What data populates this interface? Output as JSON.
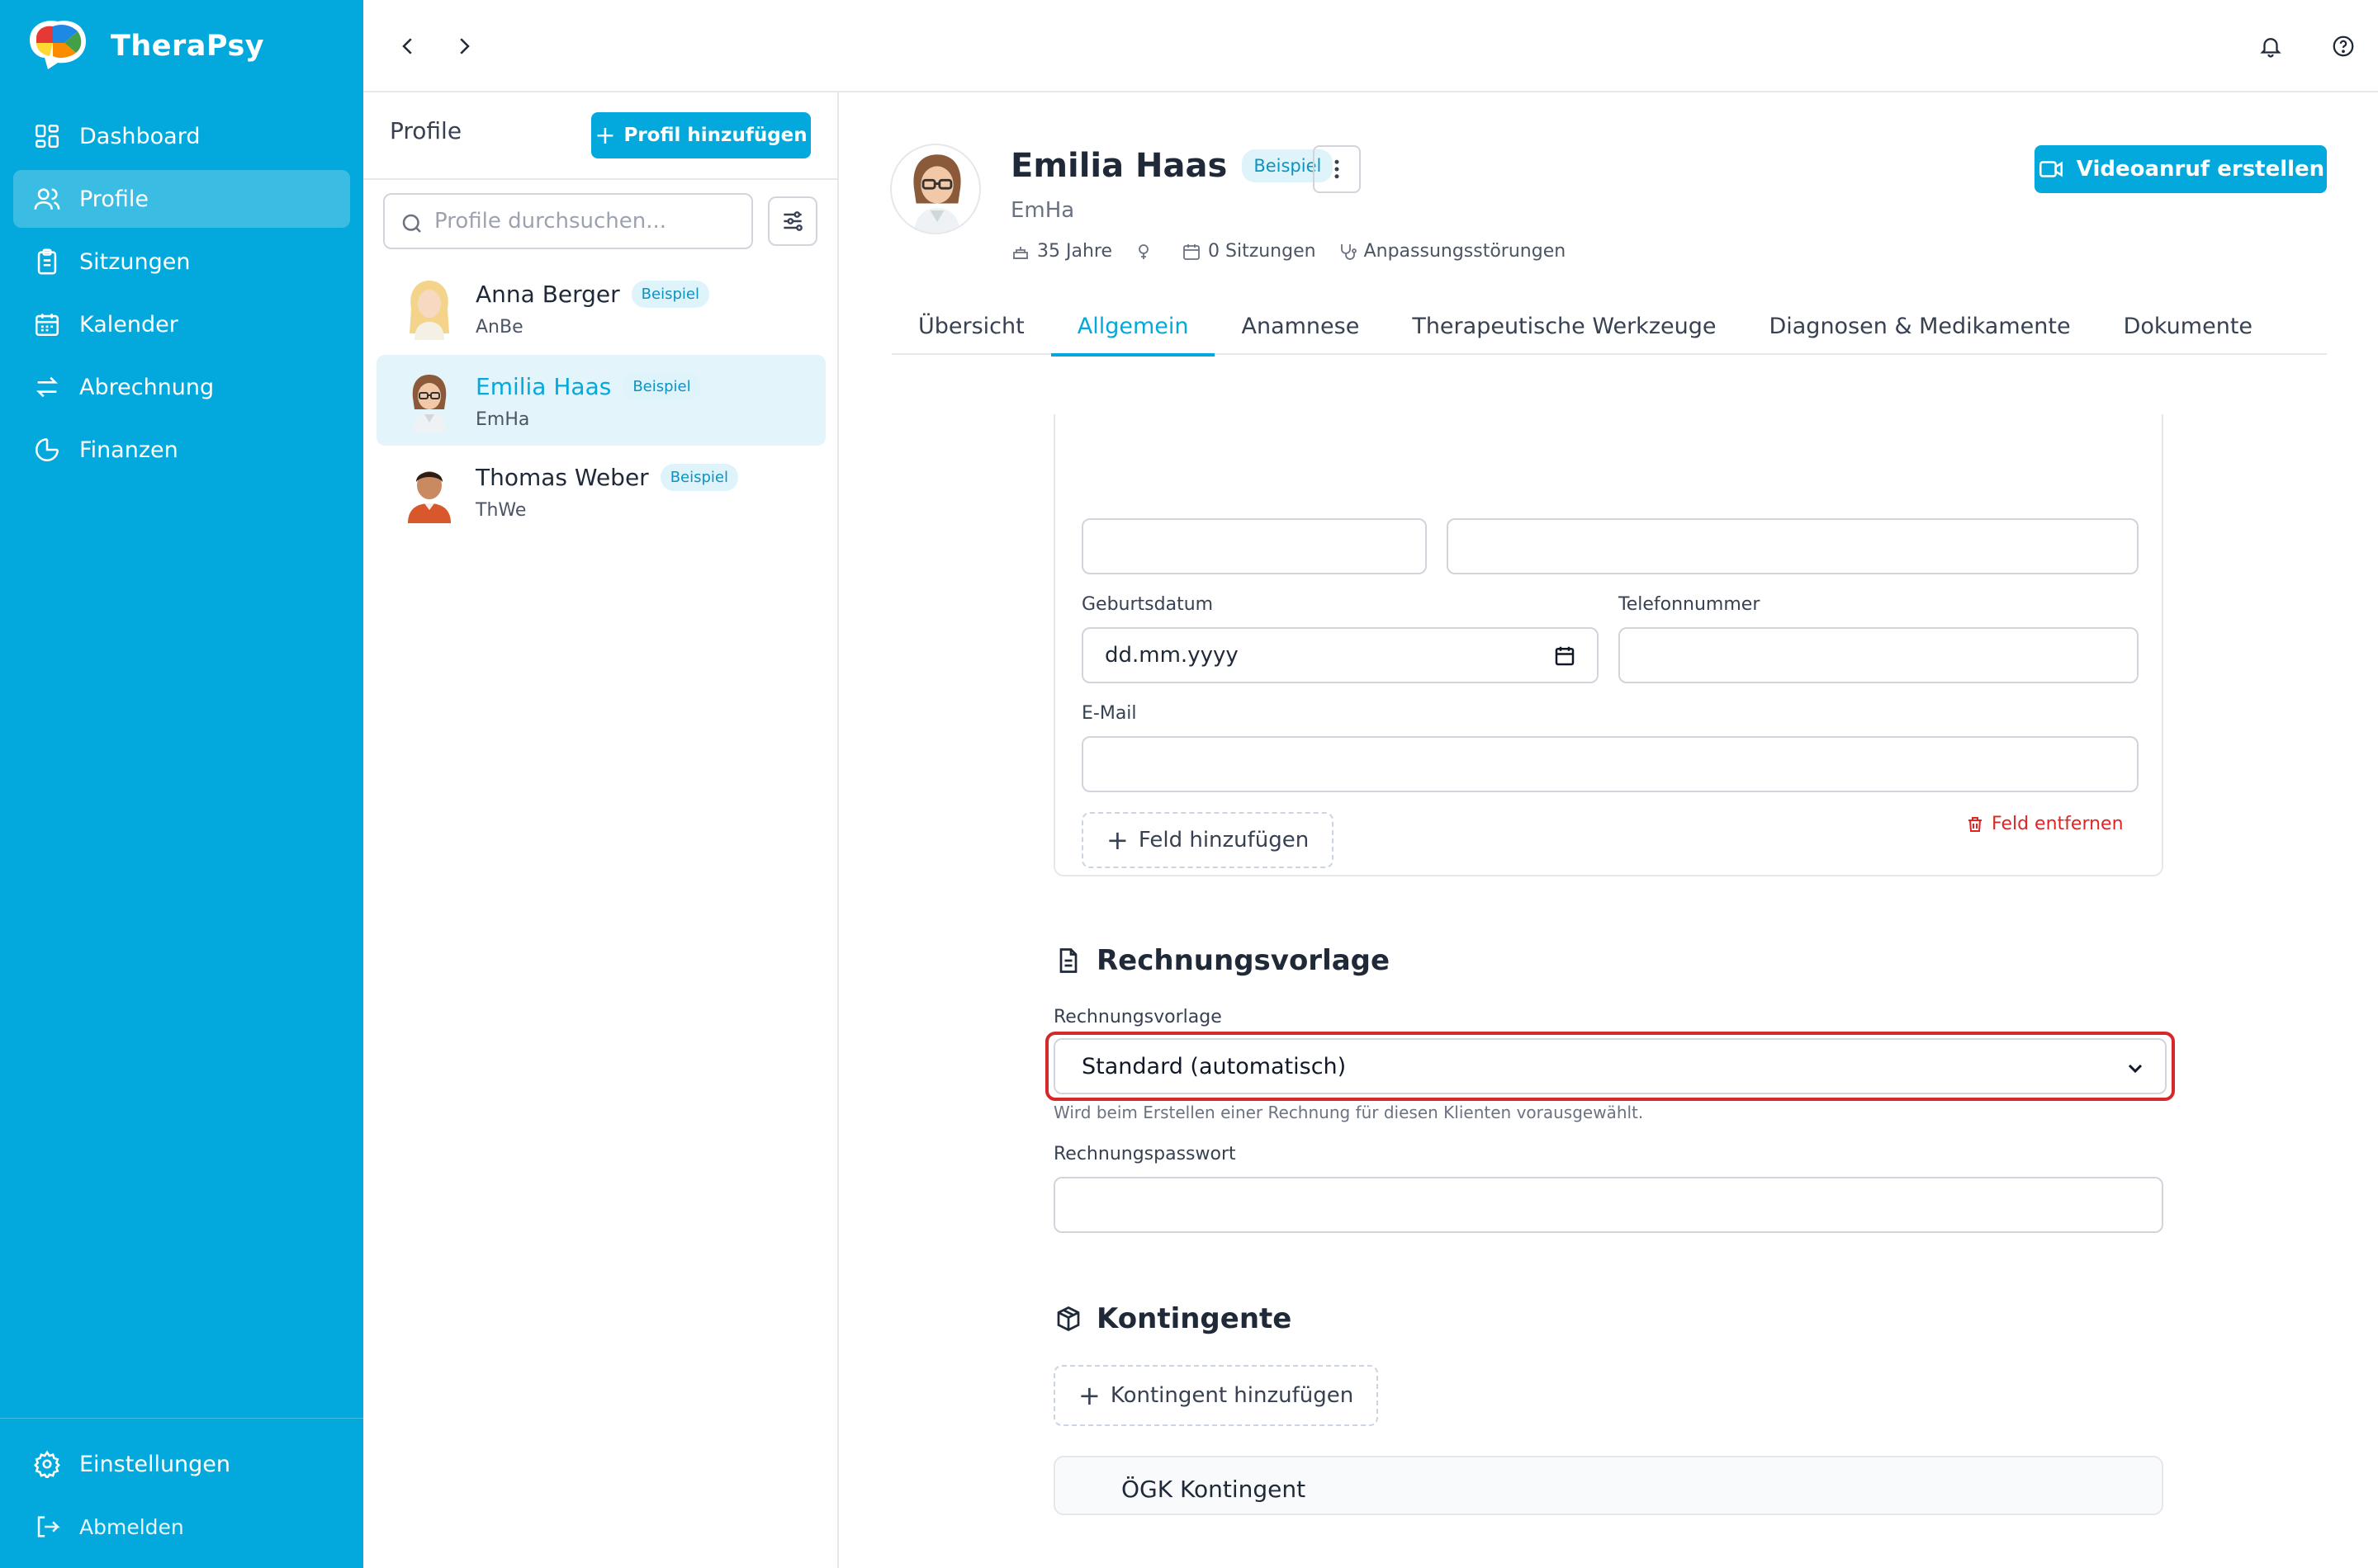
{
  "app": {
    "name": "TheraPsy",
    "colors": {
      "primary": "#03a9dc",
      "danger": "#dc2626",
      "highlight": "#d62828"
    }
  },
  "sidebar": {
    "items": [
      {
        "label": "Dashboard",
        "icon": "dashboard-icon"
      },
      {
        "label": "Profile",
        "icon": "users-icon",
        "active": true
      },
      {
        "label": "Sitzungen",
        "icon": "clipboard-icon"
      },
      {
        "label": "Kalender",
        "icon": "calendar-icon"
      },
      {
        "label": "Abrechnung",
        "icon": "arrows-exchange-icon"
      },
      {
        "label": "Finanzen",
        "icon": "pie-chart-icon"
      }
    ],
    "bottom": [
      {
        "label": "Einstellungen",
        "icon": "gear-icon"
      },
      {
        "label": "Abmelden",
        "icon": "logout-icon"
      }
    ]
  },
  "profiles_panel": {
    "title": "Profile",
    "add_label": "Profil hinzufügen",
    "search_placeholder": "Profile durchsuchen...",
    "items": [
      {
        "name": "Anna Berger",
        "short": "AnBe",
        "badge": "Beispiel"
      },
      {
        "name": "Emilia Haas",
        "short": "EmHa",
        "badge": "Beispiel",
        "active": true
      },
      {
        "name": "Thomas Weber",
        "short": "ThWe",
        "badge": "Beispiel"
      }
    ]
  },
  "profile": {
    "name": "Emilia Haas",
    "badge": "Beispiel",
    "short": "EmHa",
    "age": "35 Jahre",
    "sessions": "0 Sitzungen",
    "diagnosis": "Anpassungsstörungen",
    "video_label": "Videoanruf erstellen"
  },
  "tabs": [
    {
      "label": "Übersicht"
    },
    {
      "label": "Allgemein",
      "active": true
    },
    {
      "label": "Anamnese"
    },
    {
      "label": "Therapeutische Werkzeuge"
    },
    {
      "label": "Diagnosen & Medikamente"
    },
    {
      "label": "Dokumente"
    }
  ],
  "form": {
    "birthdate_label": "Geburtsdatum",
    "birthdate_value": "dd.mm.yyyy",
    "phone_label": "Telefonnummer",
    "email_label": "E-Mail",
    "add_field_label": "Feld hinzufügen",
    "remove_field_label": "Feld entfernen"
  },
  "invoice": {
    "title": "Rechnungsvorlage",
    "template_label": "Rechnungsvorlage",
    "template_value": "Standard (automatisch)",
    "template_hint": "Wird beim Erstellen einer Rechnung für diesen Klienten vorausgewählt.",
    "password_label": "Rechnungspasswort"
  },
  "quotas": {
    "title": "Kontingente",
    "add_label": "Kontingent hinzufügen",
    "items": [
      {
        "name": "ÖGK Kontingent"
      }
    ]
  }
}
